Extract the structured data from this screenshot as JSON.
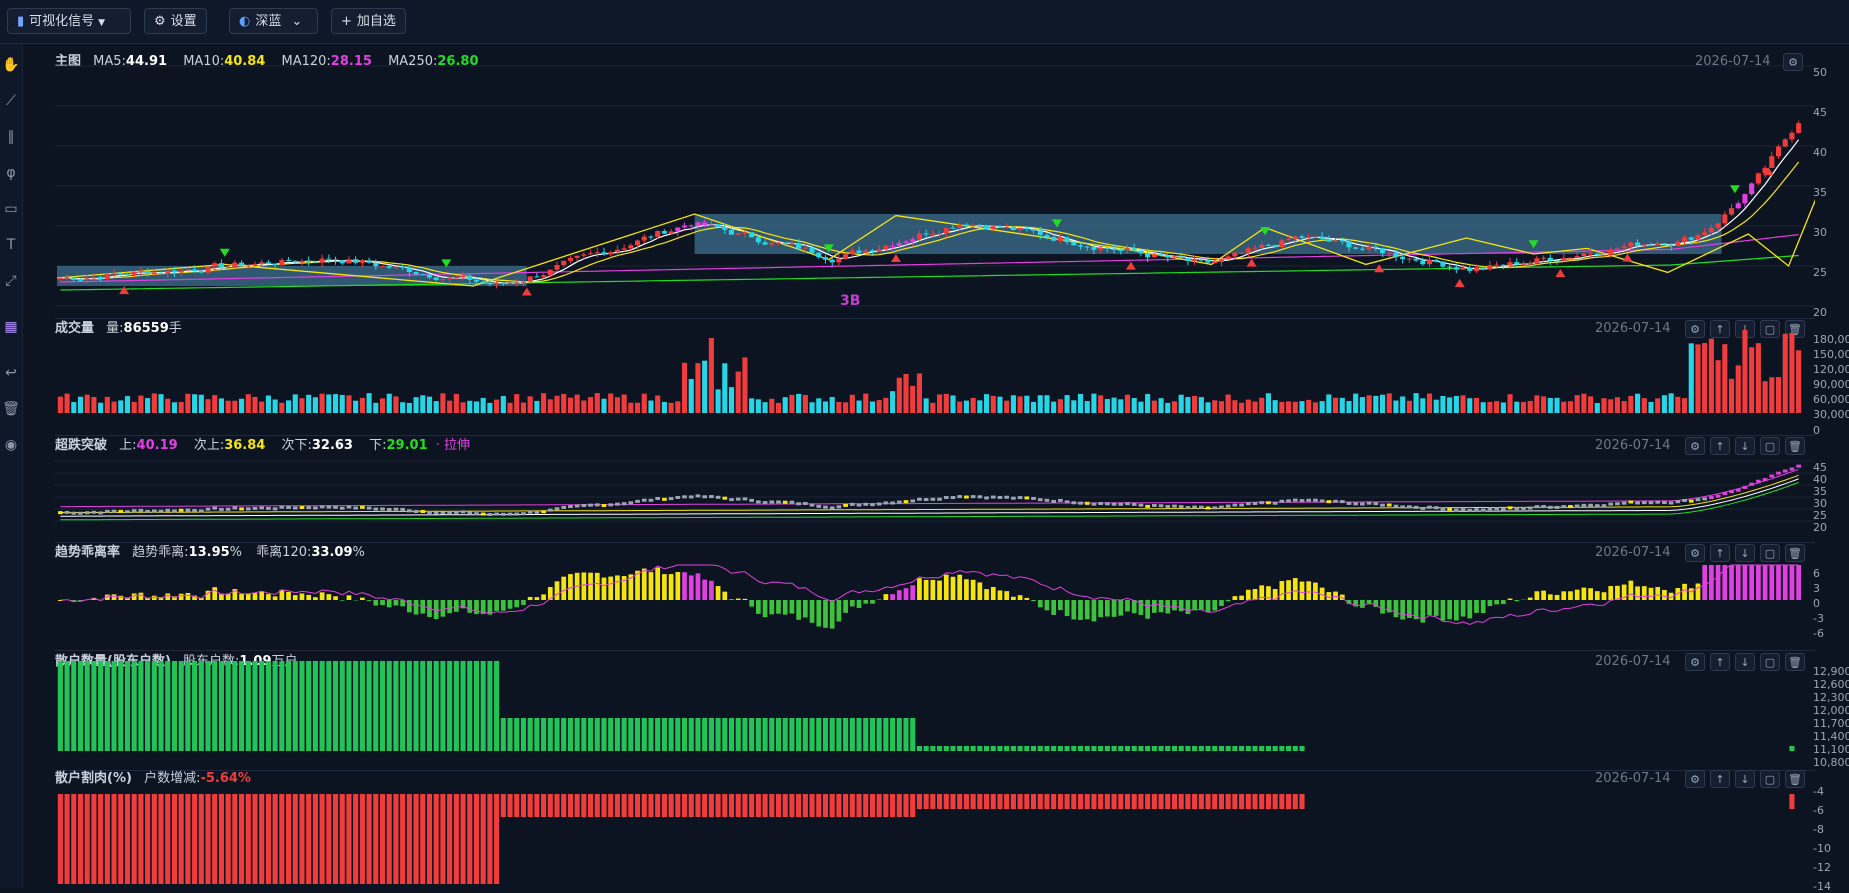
{
  "toolbar": {
    "signal_label": "可视化信号",
    "settings_label": "设置",
    "theme_label": "深蓝",
    "watchlist_label": "加自选"
  },
  "date": "2026-07-14",
  "main": {
    "title": "主图",
    "ma5_label": "MA5:",
    "ma5": "44.91",
    "ma10_label": "MA10:",
    "ma10": "40.84",
    "ma120_label": "MA120:",
    "ma120": "28.15",
    "ma250_label": "MA250:",
    "ma250": "26.80",
    "axis": [
      "50",
      "45",
      "40",
      "35",
      "30",
      "25",
      "20"
    ],
    "annotation": "3B"
  },
  "volume": {
    "title": "成交量",
    "label": "量:",
    "value": "86559",
    "unit": "手",
    "axis": [
      "180,00",
      "150,00",
      "120,00",
      "90,000",
      "60,000",
      "30,000",
      "0"
    ]
  },
  "breakout": {
    "title": "超跌突破",
    "up_label": "上:",
    "up": "40.19",
    "sub_up_label": "次上:",
    "sub_up": "36.84",
    "sub_down_label": "次下:",
    "sub_down": "32.63",
    "down_label": "下:",
    "down": "29.01",
    "status": "· 拉伸",
    "axis": [
      "45",
      "40",
      "35",
      "30",
      "25",
      "20"
    ]
  },
  "deviation": {
    "title": "趋势乖离率",
    "trend_label": "趋势乖离:",
    "trend": "13.95",
    "dev_label": "乖离120:",
    "dev": "33.09",
    "pct": "%",
    "axis": [
      "6",
      "3",
      "0",
      "-3",
      "-6"
    ]
  },
  "holders": {
    "title": "散户数量(股东户数)",
    "label": "股东户数:",
    "value": "1.09",
    "unit": "万户",
    "axis": [
      "12,900",
      "12,600",
      "12,300",
      "12,000",
      "11,700",
      "11,400",
      "11,100",
      "10,800"
    ]
  },
  "change": {
    "title": "散户割肉(%)",
    "label": "户数增减:",
    "value": "-5.64%",
    "axis": [
      "-4",
      "-6",
      "-8",
      "-10",
      "-12",
      "-14"
    ]
  },
  "colors": {
    "ma5": "#ffffff",
    "ma10": "#f5e50f",
    "ma120": "#e040e0",
    "ma250": "#22dd22",
    "up": "#f03c3c",
    "down": "#26d6e6"
  }
}
